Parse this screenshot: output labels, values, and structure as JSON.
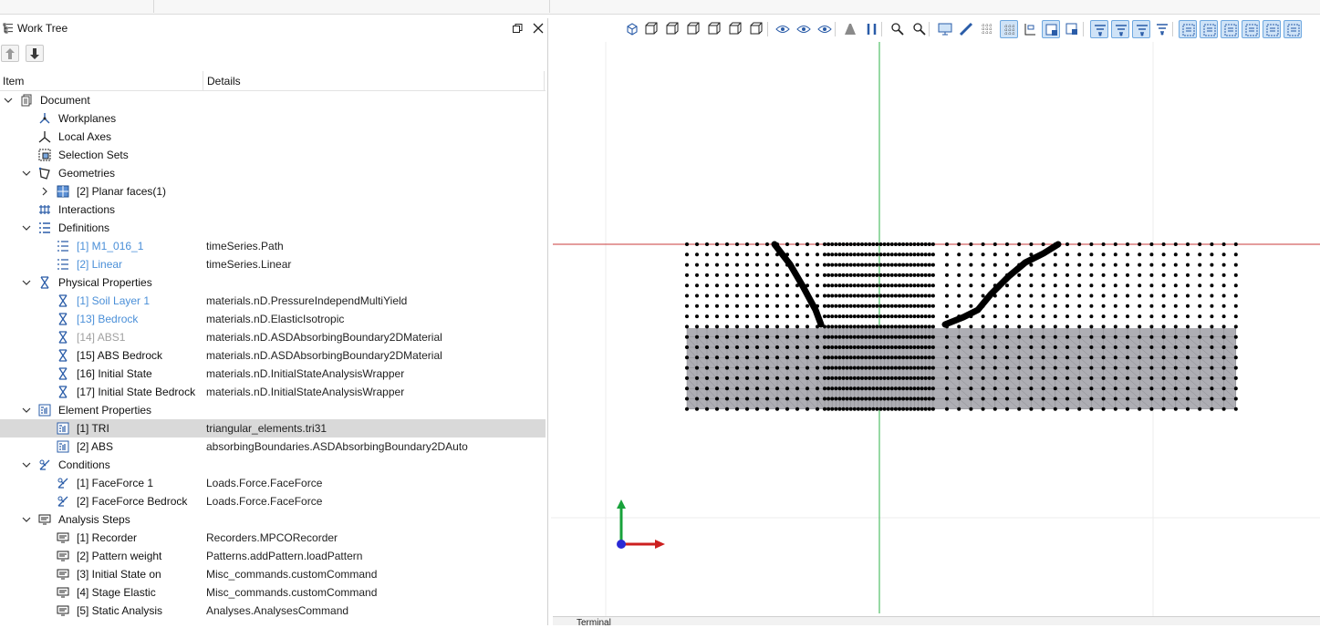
{
  "panel": {
    "title": "Work Tree",
    "col_item": "Item",
    "col_details": "Details"
  },
  "tree": [
    {
      "label": "Document",
      "details": "",
      "level": 0,
      "expand": "open",
      "icon": "document-icon",
      "style": "normal"
    },
    {
      "label": "Workplanes",
      "details": "",
      "level": 1,
      "expand": "none",
      "icon": "workplanes-icon",
      "style": "normal"
    },
    {
      "label": "Local Axes",
      "details": "",
      "level": 1,
      "expand": "none",
      "icon": "local-axes-icon",
      "style": "normal"
    },
    {
      "label": "Selection Sets",
      "details": "",
      "level": 1,
      "expand": "none",
      "icon": "selection-sets-icon",
      "style": "normal"
    },
    {
      "label": "Geometries",
      "details": "",
      "level": 1,
      "expand": "open",
      "icon": "geometries-icon",
      "style": "normal"
    },
    {
      "label": "[2] Planar faces(1)",
      "details": "",
      "level": 2,
      "expand": "closed",
      "icon": "planar-face-icon",
      "style": "normal"
    },
    {
      "label": "Interactions",
      "details": "",
      "level": 1,
      "expand": "none",
      "icon": "interactions-icon",
      "style": "normal"
    },
    {
      "label": "Definitions",
      "details": "",
      "level": 1,
      "expand": "open",
      "icon": "definitions-icon",
      "style": "normal"
    },
    {
      "label": "[1] M1_016_1",
      "details": "timeSeries.Path",
      "level": 2,
      "expand": "none",
      "icon": "definition-item-icon",
      "style": "blue"
    },
    {
      "label": "[2] Linear",
      "details": "timeSeries.Linear",
      "level": 2,
      "expand": "none",
      "icon": "definition-item-icon",
      "style": "blue"
    },
    {
      "label": "Physical Properties",
      "details": "",
      "level": 1,
      "expand": "open",
      "icon": "physical-property-icon",
      "style": "normal"
    },
    {
      "label": "[1] Soil Layer 1",
      "details": "materials.nD.PressureIndependMultiYield",
      "level": 2,
      "expand": "none",
      "icon": "physical-property-icon",
      "style": "blue"
    },
    {
      "label": "[13] Bedrock",
      "details": "materials.nD.ElasticIsotropic",
      "level": 2,
      "expand": "none",
      "icon": "physical-property-icon",
      "style": "blue"
    },
    {
      "label": "[14] ABS1",
      "details": "materials.nD.ASDAbsorbingBoundary2DMaterial",
      "level": 2,
      "expand": "none",
      "icon": "physical-property-icon",
      "style": "gray"
    },
    {
      "label": "[15] ABS Bedrock",
      "details": "materials.nD.ASDAbsorbingBoundary2DMaterial",
      "level": 2,
      "expand": "none",
      "icon": "physical-property-icon",
      "style": "normal"
    },
    {
      "label": "[16] Initial State",
      "details": "materials.nD.InitialStateAnalysisWrapper",
      "level": 2,
      "expand": "none",
      "icon": "physical-property-icon",
      "style": "normal"
    },
    {
      "label": "[17] Initial State Bedrock",
      "details": "materials.nD.InitialStateAnalysisWrapper",
      "level": 2,
      "expand": "none",
      "icon": "physical-property-icon",
      "style": "normal"
    },
    {
      "label": "Element Properties",
      "details": "",
      "level": 1,
      "expand": "open",
      "icon": "element-property-icon",
      "style": "normal"
    },
    {
      "label": "[1] TRI",
      "details": "triangular_elements.tri31",
      "level": 2,
      "expand": "none",
      "icon": "element-property-icon",
      "style": "normal",
      "selected": true
    },
    {
      "label": "[2] ABS",
      "details": "absorbingBoundaries.ASDAbsorbingBoundary2DAuto",
      "level": 2,
      "expand": "none",
      "icon": "element-property-icon",
      "style": "normal"
    },
    {
      "label": "Conditions",
      "details": "",
      "level": 1,
      "expand": "open",
      "icon": "condition-icon",
      "style": "normal"
    },
    {
      "label": "[1] FaceForce 1",
      "details": "Loads.Force.FaceForce",
      "level": 2,
      "expand": "none",
      "icon": "condition-icon",
      "style": "normal"
    },
    {
      "label": "[2] FaceForce Bedrock",
      "details": "Loads.Force.FaceForce",
      "level": 2,
      "expand": "none",
      "icon": "condition-icon",
      "style": "normal"
    },
    {
      "label": "Analysis Steps",
      "details": "",
      "level": 1,
      "expand": "open",
      "icon": "analysis-step-icon",
      "style": "normal"
    },
    {
      "label": "[1] Recorder",
      "details": "Recorders.MPCORecorder",
      "level": 2,
      "expand": "none",
      "icon": "analysis-step-icon",
      "style": "normal"
    },
    {
      "label": "[2] Pattern weight",
      "details": "Patterns.addPattern.loadPattern",
      "level": 2,
      "expand": "none",
      "icon": "analysis-step-icon",
      "style": "normal"
    },
    {
      "label": "[3] Initial State on",
      "details": "Misc_commands.customCommand",
      "level": 2,
      "expand": "none",
      "icon": "analysis-step-icon",
      "style": "normal"
    },
    {
      "label": "[4] Stage Elastic",
      "details": "Misc_commands.customCommand",
      "level": 2,
      "expand": "none",
      "icon": "analysis-step-icon",
      "style": "normal"
    },
    {
      "label": "[5] Static Analysis",
      "details": "Analyses.AnalysesCommand",
      "level": 2,
      "expand": "none",
      "icon": "analysis-step-icon",
      "style": "normal"
    }
  ],
  "viewport": {
    "bottom_tab": "Terminal",
    "toolbar_icons": [
      "iso-view-icon",
      "front-view-icon",
      "back-view-icon",
      "left-view-icon",
      "right-view-icon",
      "top-view-icon",
      "bottom-view-icon",
      "show-all-icon",
      "show-icon",
      "hide-icon",
      "perspective-icon",
      "parallel-icon",
      "fit-all-icon",
      "zoom-icon",
      "screenshot-icon",
      "measure-icon",
      "grid-icon",
      "mesh-grid-icon",
      "axis-labels-icon",
      "select-box-icon",
      "select-add-icon",
      "filter-a-icon",
      "filter-b-icon",
      "filter-c-icon",
      "filter-d-icon",
      "pick-vertex-icon",
      "pick-edge-icon",
      "pick-face-icon",
      "pick-solid-icon",
      "pick-element-icon",
      "pick-node-icon"
    ],
    "active_toolbar_icons": [
      "mesh-grid-icon",
      "select-box-icon",
      "filter-a-icon",
      "filter-b-icon",
      "filter-c-icon",
      "pick-vertex-icon",
      "pick-edge-icon",
      "pick-face-icon",
      "pick-solid-icon",
      "pick-element-icon",
      "pick-node-icon"
    ],
    "colors": {
      "mesh_fill": "#aeaeb4",
      "node": "#000000",
      "axis_x": "#c93b3b",
      "axis_y": "#2fb34a",
      "triad_x": "#cc1f1f",
      "triad_y": "#18a23b",
      "triad_origin": "#2a2ad6"
    }
  }
}
